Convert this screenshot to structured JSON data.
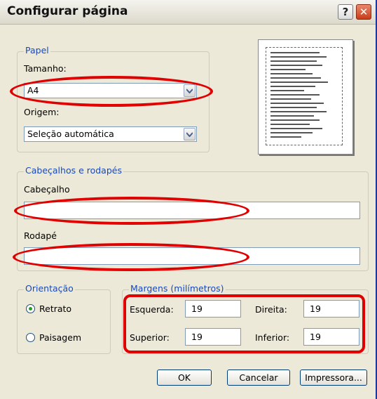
{
  "window": {
    "title": "Configurar página"
  },
  "paper": {
    "legend": "Papel",
    "size_label": "Tamanho:",
    "size_value": "A4",
    "source_label": "Origem:",
    "source_value": "Seleção automática"
  },
  "headers_footers": {
    "legend": "Cabeçalhos e rodapés",
    "header_label": "Cabeçalho",
    "header_value": "",
    "footer_label": "Rodapé",
    "footer_value": ""
  },
  "orientation": {
    "legend": "Orientação",
    "portrait_label": "Retrato",
    "landscape_label": "Paisagem",
    "selected": "Retrato"
  },
  "margins": {
    "legend": "Margens (milímetros)",
    "left_label": "Esquerda:",
    "left_value": "19",
    "right_label": "Direita:",
    "right_value": "19",
    "top_label": "Superior:",
    "top_value": "19",
    "bottom_label": "Inferior:",
    "bottom_value": "19"
  },
  "buttons": {
    "ok": "OK",
    "cancel": "Cancelar",
    "printer": "Impressora..."
  },
  "colors": {
    "dialog_bg": "#ECE9D8",
    "legend_text": "#1a4ab8",
    "annotation_red": "#e00000"
  }
}
